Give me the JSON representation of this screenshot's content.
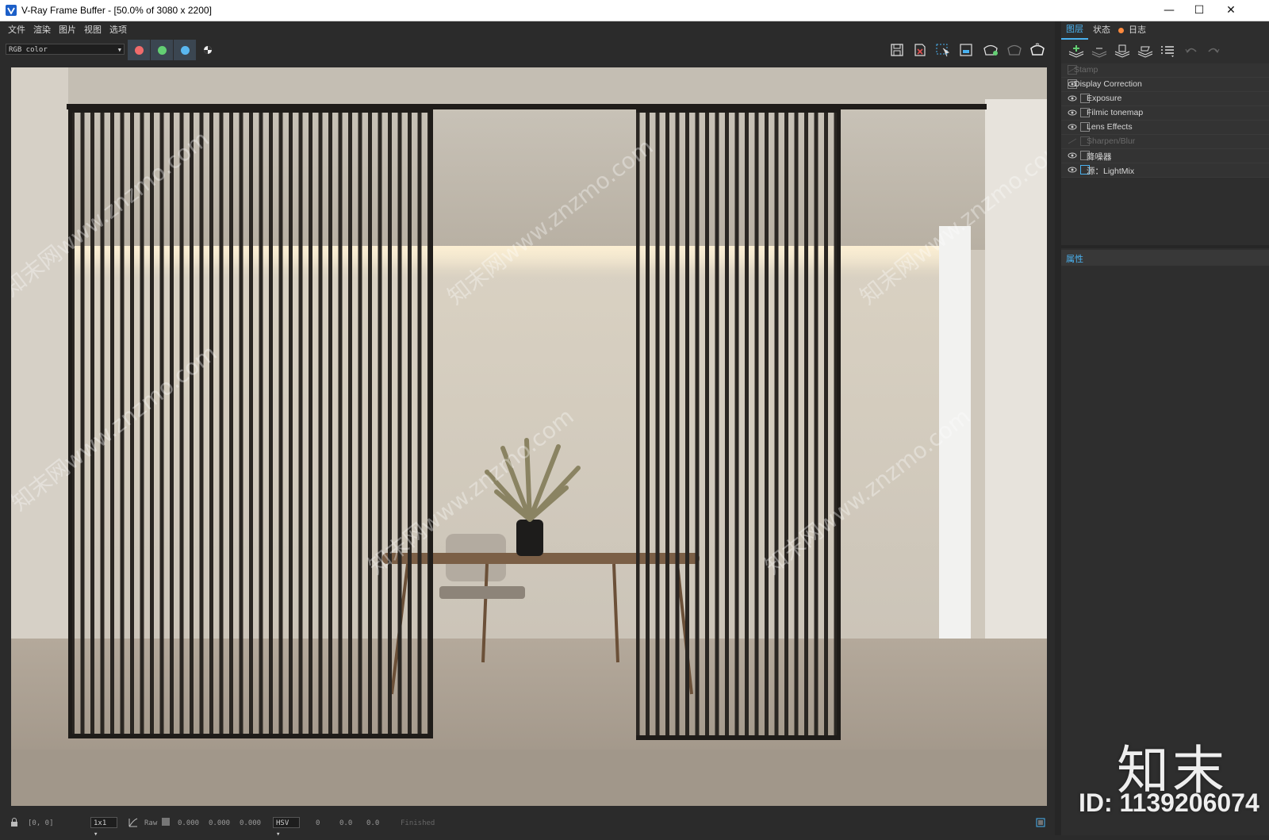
{
  "window": {
    "title": "V-Ray Frame Buffer - [50.0% of 3080 x 2200]",
    "controls": {
      "minimize": "—",
      "maximize": "☐",
      "close": "✕"
    }
  },
  "menu": [
    "文件",
    "渲染",
    "图片",
    "视图",
    "选项"
  ],
  "toolbar": {
    "channel": "RGB color",
    "channel_buttons": [
      {
        "icon": "red-channel-icon",
        "color": "#ef6b6b"
      },
      {
        "icon": "green-channel-icon",
        "color": "#63cf73"
      },
      {
        "icon": "blue-channel-icon",
        "color": "#5ab7ef"
      }
    ],
    "right_icons": [
      "save-image-icon",
      "clear-image-icon",
      "region-render-icon",
      "track-mouse-icon",
      "render-interactive-icon",
      "stop-render-icon",
      "render-icon"
    ]
  },
  "right_panel": {
    "tabs": [
      {
        "label": "图层",
        "active": true
      },
      {
        "label": "状态",
        "active": false
      },
      {
        "label": "日志",
        "active": false,
        "indicator_color": "#ff8a3d"
      }
    ],
    "tool_icons": [
      "add-layer-icon",
      "remove-layer-icon",
      "save-layer-tree-icon",
      "load-layer-tree-icon",
      "layer-presets-icon",
      "undo-icon",
      "redo-icon"
    ],
    "layers": [
      {
        "label": "Stamp",
        "visible": false,
        "indent": 0,
        "icon": "stamp-icon"
      },
      {
        "label": "Display Correction",
        "visible": true,
        "indent": 0,
        "icon": "curve-icon"
      },
      {
        "label": "Exposure",
        "visible": true,
        "indent": 1,
        "icon": "exposure-icon"
      },
      {
        "label": "Filmic tonemap",
        "visible": true,
        "indent": 1,
        "icon": "filmic-icon"
      },
      {
        "label": "Lens Effects",
        "visible": true,
        "indent": 1,
        "icon": "lens-effects-icon"
      },
      {
        "label": "Sharpen/Blur",
        "visible": false,
        "indent": 1,
        "icon": "sharpen-icon"
      },
      {
        "label": "降噪器",
        "visible": true,
        "indent": 1,
        "icon": "denoiser-icon"
      },
      {
        "label": "源：LightMix",
        "visible": true,
        "indent": 1,
        "icon": "lightmix-icon"
      }
    ],
    "properties_label": "属性"
  },
  "status": {
    "coords": "[0, 0]",
    "zoom": "1x1",
    "raw_label": "Raw",
    "rgb": [
      "0.000",
      "0.000",
      "0.000"
    ],
    "color_mode": "HSV",
    "hsv": [
      "0",
      "0.0",
      "0.0"
    ],
    "message": "Finished"
  },
  "watermark": {
    "brand": "知末",
    "id": "ID: 1139206074",
    "diagonal_text": "知末网www.znzmo.com"
  }
}
